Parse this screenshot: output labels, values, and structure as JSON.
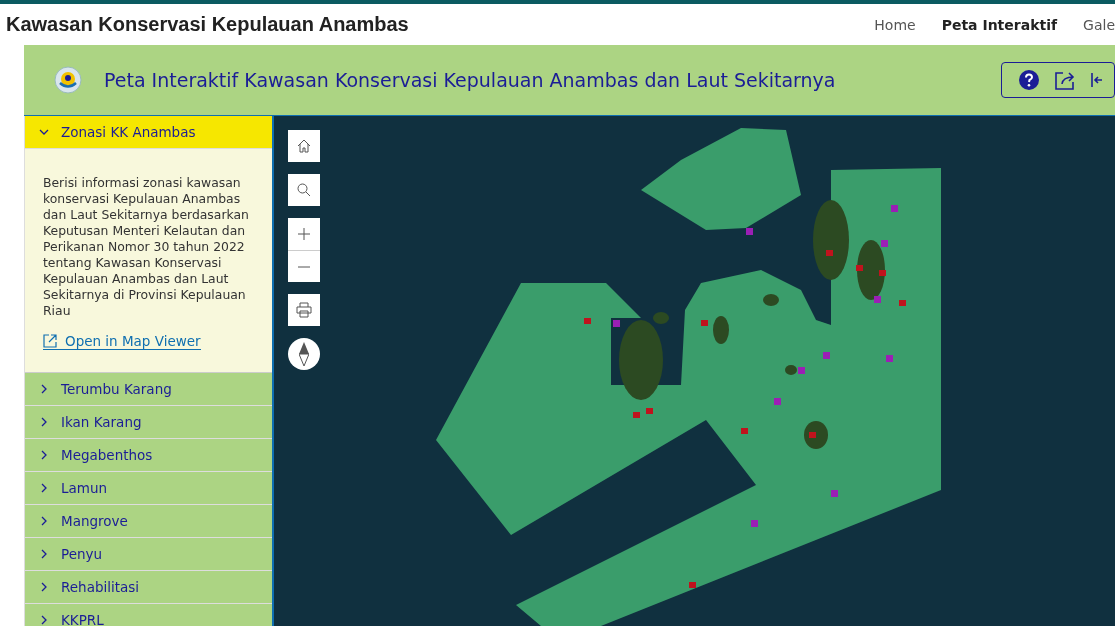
{
  "site": {
    "title": "Kawasan Konservasi Kepulauan Anambas"
  },
  "nav": [
    {
      "label": "Home",
      "selected": false
    },
    {
      "label": "Peta Interaktif",
      "selected": true
    },
    {
      "label": "Gale",
      "selected": false
    }
  ],
  "app": {
    "title": "Peta Interaktif Kawasan Konservasi Kepulauan Anambas dan Laut Sekitarnya"
  },
  "sidebar": {
    "sections": [
      {
        "title": "Zonasi KK Anambas",
        "expanded": true,
        "description": "Berisi informasi zonasi kawasan konservasi Kepulauan Anambas dan Laut Sekitarnya berdasarkan Keputusan Menteri Kelautan dan Perikanan Nomor 30 tahun 2022 tentang Kawasan Konservasi Kepulauan Anambas dan Laut Sekitarnya di Provinsi Kepulauan Riau",
        "link": "Open in Map Viewer"
      },
      {
        "title": "Terumbu Karang",
        "expanded": false
      },
      {
        "title": "Ikan Karang",
        "expanded": false
      },
      {
        "title": "Megabenthos",
        "expanded": false
      },
      {
        "title": "Lamun",
        "expanded": false
      },
      {
        "title": "Mangrove",
        "expanded": false
      },
      {
        "title": "Penyu",
        "expanded": false
      },
      {
        "title": "Rehabilitasi",
        "expanded": false
      },
      {
        "title": "KKPRL",
        "expanded": false
      }
    ]
  }
}
